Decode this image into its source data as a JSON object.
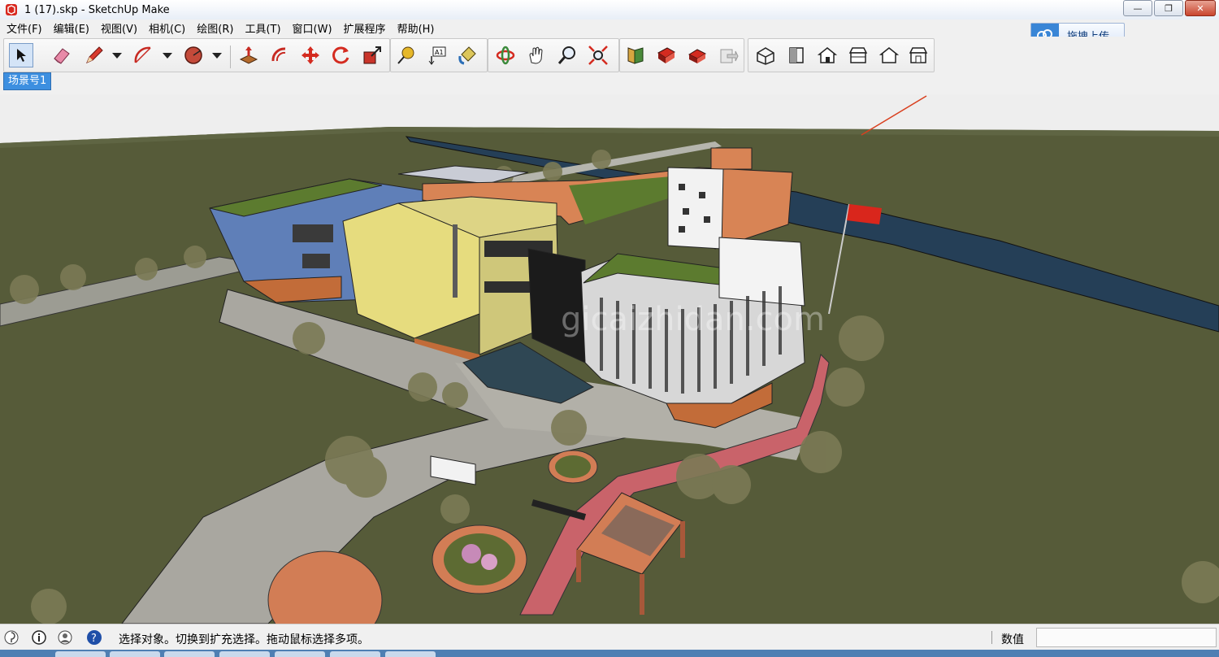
{
  "window": {
    "title": "1 (17).skp - SketchUp Make",
    "minimize_label": "—",
    "restore_label": "❐",
    "close_label": "✕"
  },
  "menu": [
    "文件(F)",
    "编辑(E)",
    "视图(V)",
    "相机(C)",
    "绘图(R)",
    "工具(T)",
    "窗口(W)",
    "扩展程序",
    "帮助(H)"
  ],
  "upload_button": {
    "label": "拖拽上传",
    "icon": "cloud-upload-icon"
  },
  "toolbar": {
    "tools": [
      "select-tool-icon",
      "eraser-tool-icon",
      "pencil-line-tool-icon",
      "arc-tool-icon",
      "shape-tool-icon",
      "push-pull-tool-icon",
      "offset-tool-icon",
      "move-tool-icon",
      "rotate-tool-icon",
      "scale-tool-icon",
      "tape-measure-tool-icon",
      "text-tool-icon",
      "paint-bucket-tool-icon",
      "orbit-tool-icon",
      "pan-tool-icon",
      "zoom-tool-icon",
      "zoom-extents-tool-icon",
      "3d-warehouse-icon",
      "share-model-icon",
      "extension-warehouse-icon",
      "send-to-layout-icon",
      "iso-view-icon",
      "top-view-icon",
      "front-view-icon",
      "right-view-icon",
      "back-view-icon",
      "left-view-icon"
    ]
  },
  "scene_tab": {
    "label": "场景号1"
  },
  "viewport": {
    "watermark": "gicaizhidan.com"
  },
  "status_bar": {
    "message": "选择对象。切换到扩充选择。拖动鼠标选择多项。",
    "value_label": "数值",
    "value": ""
  },
  "colors": {
    "ground": "#575c3a",
    "sky": "#eeeeee",
    "accent_blue": "#3d8fe0"
  }
}
